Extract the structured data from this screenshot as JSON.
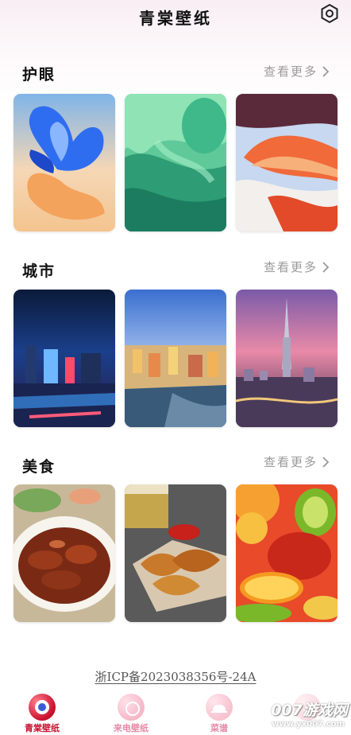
{
  "header": {
    "title": "青棠壁纸",
    "settings_icon": "settings-hexagon-icon"
  },
  "sections": [
    {
      "title": "护眼",
      "more": "查看更多"
    },
    {
      "title": "城市",
      "more": "查看更多"
    },
    {
      "title": "美食",
      "more": "查看更多"
    }
  ],
  "icp": "浙ICP备2023038356号-24A",
  "tabs": [
    {
      "label": "青棠壁纸",
      "active": true,
      "color": "#c8102e"
    },
    {
      "label": "来电壁纸",
      "active": false,
      "color": "#e58aa6"
    },
    {
      "label": "菜谱",
      "active": false,
      "color": "#e58aa6"
    }
  ],
  "watermark": {
    "brand": "007游戏网",
    "url": "www.yx007.com"
  }
}
